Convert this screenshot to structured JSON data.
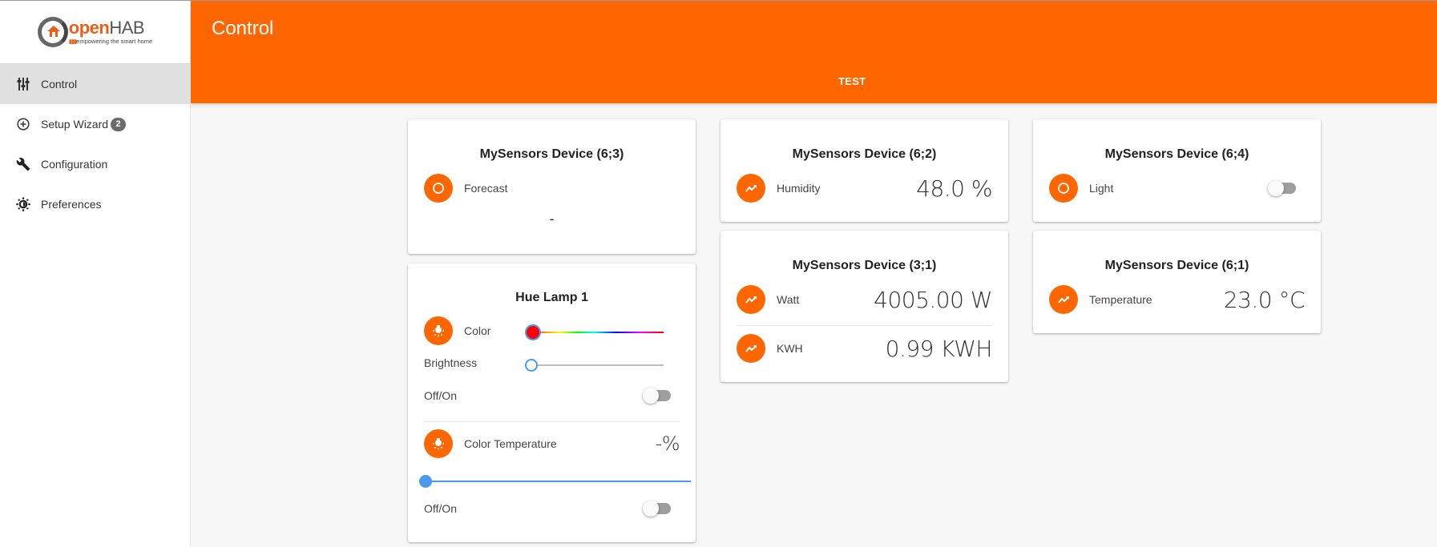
{
  "app": {
    "logo_text_open": "open",
    "logo_text_hab": "HAB",
    "logo_tagline": "empowering the smart home",
    "logo_dots": "▮▮▮"
  },
  "sidebar": {
    "items": [
      {
        "label": "Control",
        "icon": "sliders-icon",
        "active": true
      },
      {
        "label": "Setup Wizard",
        "icon": "add-circle-icon",
        "badge": "2"
      },
      {
        "label": "Configuration",
        "icon": "wrench-icon"
      },
      {
        "label": "Preferences",
        "icon": "brightness-icon"
      }
    ]
  },
  "header": {
    "title": "Control",
    "tab": "TEST"
  },
  "colors": {
    "accent": "#ff6600",
    "slider_blue": "#4c9af0",
    "toggle_off": "#9e9e9e"
  },
  "cards": {
    "forecast": {
      "title": "MySensors Device (6;3)",
      "label": "Forecast",
      "icon": "circle-outline-icon",
      "value": "-"
    },
    "humidity": {
      "title": "MySensors Device (6;2)",
      "label": "Humidity",
      "icon": "trending-up-icon",
      "value": "48.0 %"
    },
    "light": {
      "title": "MySensors Device (6;4)",
      "label": "Light",
      "icon": "circle-outline-icon",
      "switch_on": false
    },
    "power": {
      "title": "MySensors Device (3;1)",
      "rows": [
        {
          "label": "Watt",
          "icon": "trending-up-icon",
          "value": "4005.00 W"
        },
        {
          "label": "KWH",
          "icon": "trending-up-icon",
          "value": "0.99 KWH"
        }
      ]
    },
    "temperature": {
      "title": "MySensors Device (6;1)",
      "label": "Temperature",
      "icon": "trending-up-icon",
      "value": "23.0 °C"
    },
    "hue": {
      "title": "Hue Lamp 1",
      "color_label": "Color",
      "color_hue_value": 0,
      "color_thumb": "#ff0000",
      "brightness_label": "Brightness",
      "brightness_value_percent": 0,
      "offon_label": "Off/On",
      "offon_on": false,
      "color_temp_label": "Color Temperature",
      "color_temp_value": "-%",
      "color_temp_slider_percent": 0,
      "offon2_label": "Off/On",
      "offon2_on": false
    }
  }
}
